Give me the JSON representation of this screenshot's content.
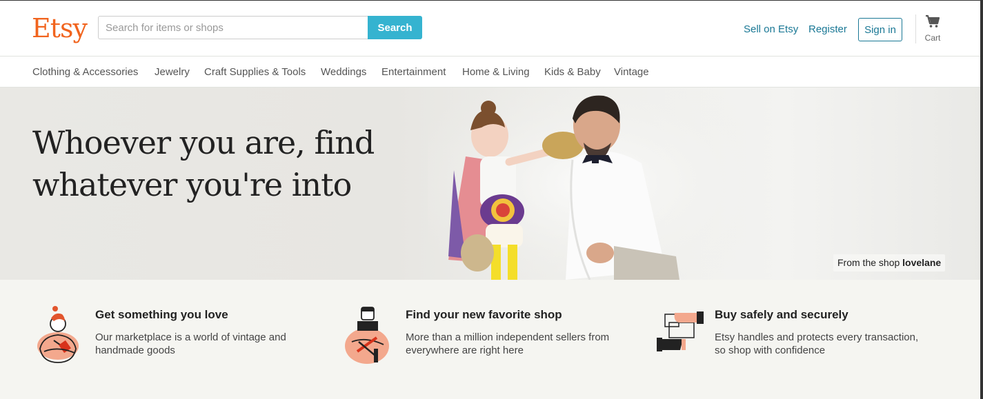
{
  "brand": {
    "logo": "Etsy",
    "accent": "#f1641e",
    "link_color": "#1a7895",
    "search_color": "#35b3d0"
  },
  "search": {
    "placeholder": "Search for items or shops",
    "button_label": "Search"
  },
  "header": {
    "sell_link": "Sell on Etsy",
    "register_link": "Register",
    "signin_button": "Sign in",
    "cart_label": "Cart",
    "cart_icon": "cart-icon"
  },
  "categories": [
    "Clothing & Accessories",
    "Jewelry",
    "Craft Supplies & Tools",
    "Weddings",
    "Entertainment",
    "Home & Living",
    "Kids & Baby",
    "Vintage"
  ],
  "hero": {
    "line1": "Whoever you are, find",
    "line2": "whatever you're into",
    "credit_prefix": "From the shop",
    "credit_shop": "lovelane"
  },
  "features": [
    {
      "title": "Get something you love",
      "text": "Our marketplace is a world of vintage and handmade goods",
      "icon": "person-holding-item-icon"
    },
    {
      "title": "Find your new favorite shop",
      "text": "More than a million independent sellers from everywhere are right here",
      "icon": "seller-crafting-icon"
    },
    {
      "title": "Buy safely and securely",
      "text": "Etsy handles and protects every transaction, so shop with confidence",
      "icon": "hands-exchange-icon"
    }
  ]
}
